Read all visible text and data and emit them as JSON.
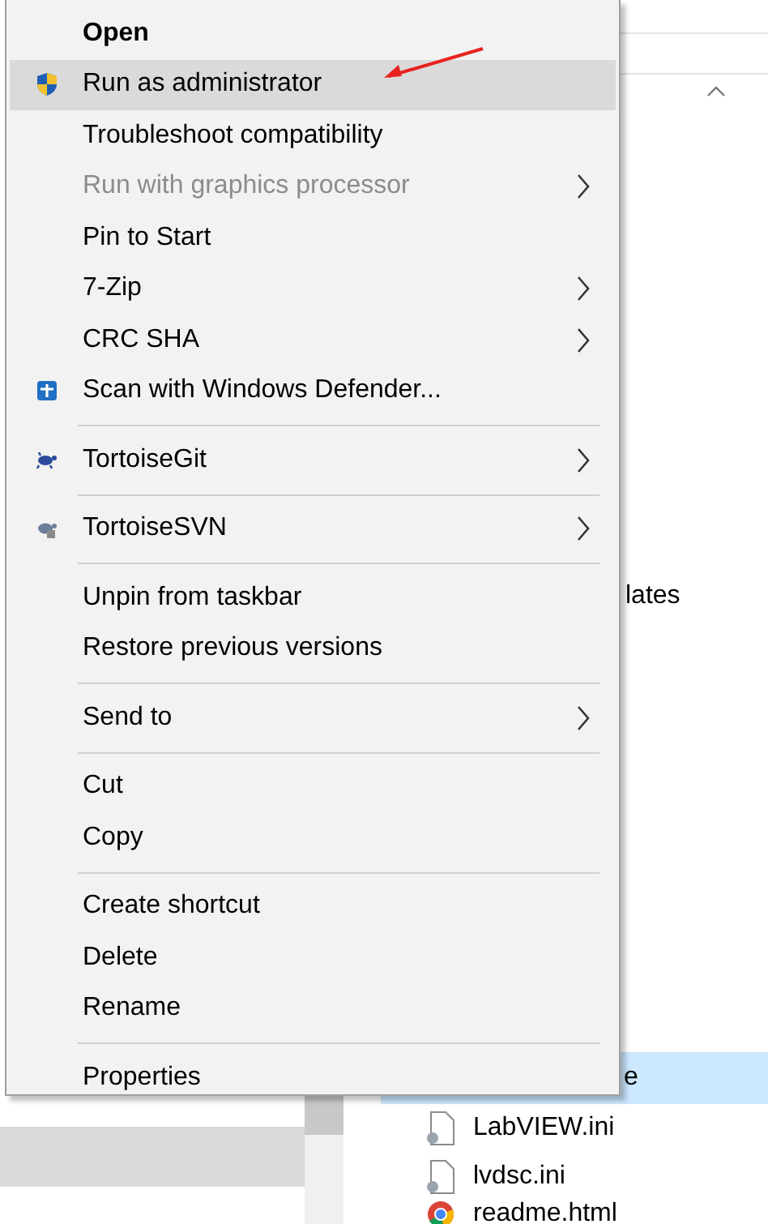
{
  "explorer": {
    "files": [
      {
        "name": "lates",
        "selected": false
      },
      {
        "name": "e",
        "selected": true
      },
      {
        "name": "LabVIEW.ini",
        "selected": false
      },
      {
        "name": "lvdsc.ini",
        "selected": false
      },
      {
        "name": "readme.html",
        "selected": false
      }
    ]
  },
  "context_menu": {
    "items": [
      {
        "kind": "item",
        "label": "Open",
        "default": true,
        "selected": false,
        "disabled": false,
        "submenu": false
      },
      {
        "kind": "item",
        "label": "Run as administrator",
        "default": false,
        "selected": true,
        "disabled": false,
        "submenu": false
      },
      {
        "kind": "item",
        "label": "Troubleshoot compatibility",
        "default": false,
        "selected": false,
        "disabled": false,
        "submenu": false
      },
      {
        "kind": "item",
        "label": "Run with graphics processor",
        "default": false,
        "selected": false,
        "disabled": true,
        "submenu": true
      },
      {
        "kind": "item",
        "label": "Pin to Start",
        "default": false,
        "selected": false,
        "disabled": false,
        "submenu": false
      },
      {
        "kind": "item",
        "label": "7-Zip",
        "default": false,
        "selected": false,
        "disabled": false,
        "submenu": true
      },
      {
        "kind": "item",
        "label": "CRC SHA",
        "default": false,
        "selected": false,
        "disabled": false,
        "submenu": true
      },
      {
        "kind": "item",
        "label": "Scan with Windows Defender...",
        "default": false,
        "selected": false,
        "disabled": false,
        "submenu": false
      },
      {
        "kind": "separator"
      },
      {
        "kind": "item",
        "label": "TortoiseGit",
        "default": false,
        "selected": false,
        "disabled": false,
        "submenu": true
      },
      {
        "kind": "separator"
      },
      {
        "kind": "item",
        "label": "TortoiseSVN",
        "default": false,
        "selected": false,
        "disabled": false,
        "submenu": true
      },
      {
        "kind": "separator"
      },
      {
        "kind": "item",
        "label": "Unpin from taskbar",
        "default": false,
        "selected": false,
        "disabled": false,
        "submenu": false
      },
      {
        "kind": "item",
        "label": "Restore previous versions",
        "default": false,
        "selected": false,
        "disabled": false,
        "submenu": false
      },
      {
        "kind": "separator"
      },
      {
        "kind": "item",
        "label": "Send to",
        "default": false,
        "selected": false,
        "disabled": false,
        "submenu": true
      },
      {
        "kind": "separator"
      },
      {
        "kind": "item",
        "label": "Cut",
        "default": false,
        "selected": false,
        "disabled": false,
        "submenu": false
      },
      {
        "kind": "item",
        "label": "Copy",
        "default": false,
        "selected": false,
        "disabled": false,
        "submenu": false
      },
      {
        "kind": "separator"
      },
      {
        "kind": "item",
        "label": "Create shortcut",
        "default": false,
        "selected": false,
        "disabled": false,
        "submenu": false
      },
      {
        "kind": "item",
        "label": "Delete",
        "default": false,
        "selected": false,
        "disabled": false,
        "submenu": false
      },
      {
        "kind": "item",
        "label": "Rename",
        "default": false,
        "selected": false,
        "disabled": false,
        "submenu": false
      },
      {
        "kind": "separator"
      },
      {
        "kind": "item",
        "label": "Properties",
        "default": false,
        "selected": false,
        "disabled": false,
        "submenu": false
      }
    ]
  }
}
